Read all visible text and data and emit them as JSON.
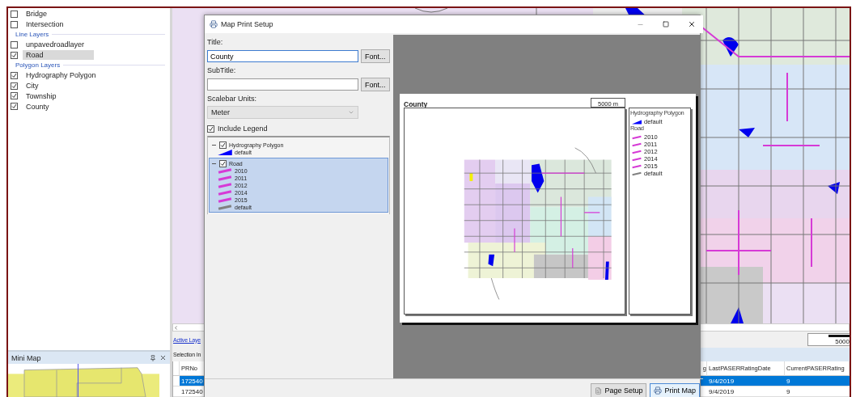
{
  "layers": [
    {
      "kind": "item",
      "label": "Bridge",
      "checked": false,
      "selected": false
    },
    {
      "kind": "item",
      "label": "Intersection",
      "checked": false,
      "selected": false
    },
    {
      "kind": "header",
      "label": "Line Layers"
    },
    {
      "kind": "item",
      "label": "unpavedroadlayer",
      "checked": false,
      "selected": false
    },
    {
      "kind": "item",
      "label": "Road",
      "checked": true,
      "selected": true
    },
    {
      "kind": "header",
      "label": "Polygon Layers"
    },
    {
      "kind": "item",
      "label": "Hydrography Polygon",
      "checked": true,
      "selected": false
    },
    {
      "kind": "item",
      "label": "City",
      "checked": true,
      "selected": false
    },
    {
      "kind": "item",
      "label": "Township",
      "checked": true,
      "selected": false
    },
    {
      "kind": "item",
      "label": "County",
      "checked": true,
      "selected": false
    }
  ],
  "mini_map": {
    "title": "Mini Map"
  },
  "active_layer_link": "Active Laye",
  "map_scale": "5000",
  "selection": {
    "title": "Selection In",
    "columns": [
      "PRNo",
      "g",
      "LastPASERRatingDate",
      "CurrentPASERRating"
    ],
    "rows": [
      {
        "selected": true,
        "cells": [
          "172540",
          "",
          "9/4/2019",
          "9"
        ]
      },
      {
        "selected": false,
        "cells": [
          "172540",
          "",
          "9/4/2019",
          "9"
        ]
      }
    ]
  },
  "dialog": {
    "title": "Map Print Setup",
    "title_label": "Title:",
    "title_value": "County",
    "font_button": "Font...",
    "subtitle_label": "SubTitle:",
    "subtitle_font_button": "Font...",
    "scalebar_label": "Scalebar Units:",
    "scalebar_value": "Meter",
    "include_legend": {
      "label": "Include Legend",
      "checked": true
    },
    "legend": [
      {
        "name": "Hydrography Polygon",
        "checked": true,
        "expanded": true,
        "selected": false,
        "symbols": [
          {
            "kind": "fill",
            "label": "default",
            "color": "#0000ff"
          }
        ]
      },
      {
        "name": "Road",
        "checked": true,
        "expanded": true,
        "selected": true,
        "symbols": [
          {
            "kind": "line",
            "label": "2010",
            "color": "#d63ad6"
          },
          {
            "kind": "line",
            "label": "2011",
            "color": "#d63ad6"
          },
          {
            "kind": "line",
            "label": "2012",
            "color": "#d63ad6"
          },
          {
            "kind": "line",
            "label": "2014",
            "color": "#d63ad6"
          },
          {
            "kind": "line",
            "label": "2015",
            "color": "#d63ad6"
          },
          {
            "kind": "line",
            "label": "default",
            "color": "#808080"
          }
        ]
      }
    ],
    "preview": {
      "title": "County",
      "scale": "5000 m",
      "legend": [
        {
          "name": "Hydrography Polygon",
          "symbols": [
            {
              "kind": "fill",
              "label": "default",
              "color": "#0000ff"
            }
          ]
        },
        {
          "name": "Road",
          "symbols": [
            {
              "kind": "line",
              "label": "2010",
              "color": "#d63ad6"
            },
            {
              "kind": "line",
              "label": "2011",
              "color": "#d63ad6"
            },
            {
              "kind": "line",
              "label": "2012",
              "color": "#d63ad6"
            },
            {
              "kind": "line",
              "label": "2014",
              "color": "#d63ad6"
            },
            {
              "kind": "line",
              "label": "2015",
              "color": "#d63ad6"
            },
            {
              "kind": "line",
              "label": "default",
              "color": "#808080"
            }
          ]
        }
      ]
    },
    "buttons": [
      "Page Setup",
      "Print Map"
    ]
  }
}
